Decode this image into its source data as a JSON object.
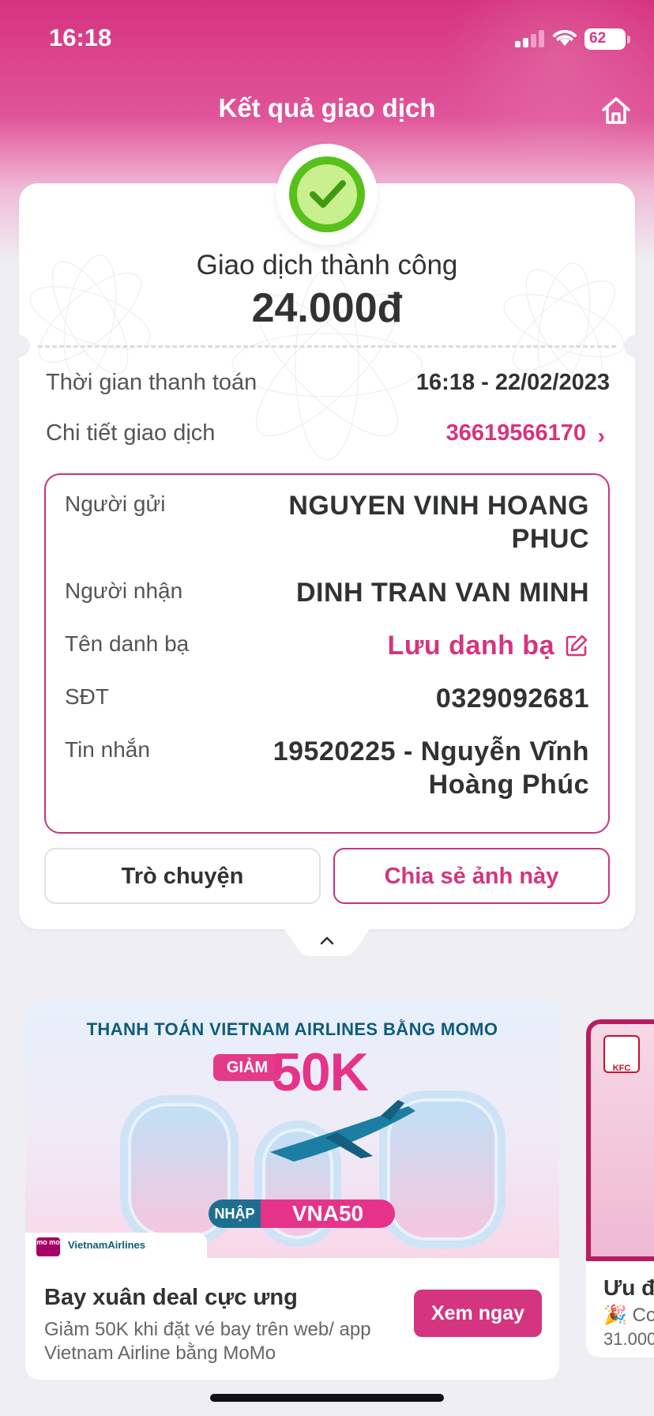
{
  "status_bar": {
    "time": "16:18",
    "battery": "62"
  },
  "header": {
    "title": "Kết quả giao dịch"
  },
  "result": {
    "status": "Giao dịch thành công",
    "amount": "24.000đ"
  },
  "info": {
    "time_label": "Thời gian thanh toán",
    "time_value": "16:18 - 22/02/2023",
    "detail_label": "Chi tiết giao dịch",
    "detail_value": "36619566170"
  },
  "details": {
    "sender_label": "Người gửi",
    "sender_line1": "NGUYEN VINH HOANG",
    "sender_line2": "PHUC",
    "receiver_label": "Người nhận",
    "receiver_value": "DINH TRAN VAN MINH",
    "contact_label": "Tên danh bạ",
    "contact_value": "Lưu danh bạ",
    "phone_label": "SĐT",
    "phone_value": "0329092681",
    "message_label": "Tin nhắn",
    "message_line1": "19520225 - Nguyễn Vĩnh",
    "message_line2": "Hoàng Phúc"
  },
  "actions": {
    "chat": "Trò chuyện",
    "share": "Chia sẻ ảnh này"
  },
  "promo": {
    "banner_headline": "THANH TOÁN VIETNAM AIRLINES BẰNG MOMO",
    "banner_giam": "GIẢM",
    "banner_amount": "50K",
    "banner_nhap": "NHẬP",
    "banner_code": "VNA50",
    "logo_momo": "mo mo",
    "logo_vna": "VietnamAirlines",
    "title": "Bay xuân deal cực ưng",
    "description": "Giảm 50K khi đặt vé bay trên web/ app Vietnam Airline bằng MoMo",
    "button": "Xem ngay"
  },
  "promo2": {
    "logo": "KFC",
    "title": "Ưu đ",
    "subtitle": "🎉 Co",
    "price": "31.000"
  },
  "colors": {
    "brand": "#d5347f",
    "success": "#58c01b"
  }
}
